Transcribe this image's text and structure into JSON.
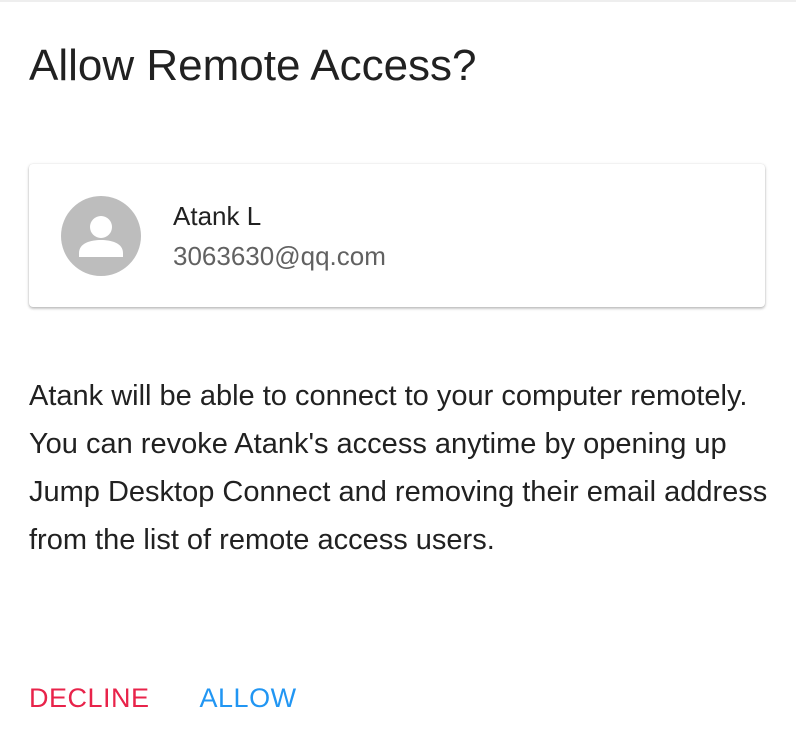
{
  "dialog": {
    "title": "Allow Remote Access?"
  },
  "user": {
    "name": "Atank L",
    "email": "3063630@qq.com",
    "avatar_icon": "person-icon"
  },
  "body": {
    "message": "Atank will be able to connect to your computer remotely. You can revoke Atank's access anytime by opening up Jump Desktop Connect and removing their email address from the list of remote access users."
  },
  "actions": {
    "decline_label": "DECLINE",
    "allow_label": "ALLOW"
  },
  "colors": {
    "decline": "#e8234a",
    "allow": "#2196f3",
    "avatar_bg": "#bdbdbd"
  }
}
